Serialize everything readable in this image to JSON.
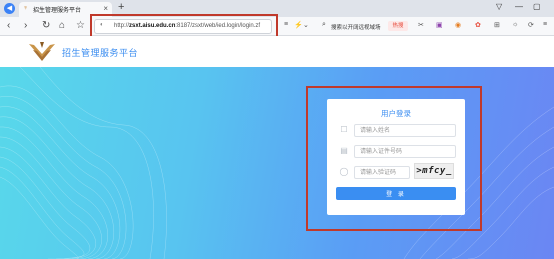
{
  "browser": {
    "tab_title": "招生管理服务平台",
    "new_tab": "+",
    "url_prefix": "http://",
    "url_host": "zsxt.aisu.edu.cn",
    "url_rest": ":8187/zsxt/web/ied.login/login.zf",
    "search_placeholder": "搜索以开阔远视域场",
    "hot_badge": "热搜",
    "icons": [
      "back-icon",
      "forward-icon",
      "reload-icon",
      "home-icon",
      "star-icon",
      "lock-icon",
      "menu-icon",
      "lightning-icon",
      "chevron-down-icon",
      "search-icon",
      "cut-icon",
      "translate-icon",
      "extension-icon",
      "profile-icon",
      "grid-icon",
      "settings-icon",
      "menu-icon"
    ]
  },
  "site": {
    "title": "招生管理服务平台"
  },
  "login": {
    "title": "用户登录",
    "name_placeholder": "请输入姓名",
    "id_placeholder": "请输入证件号码",
    "captcha_placeholder": "请输入验证码",
    "captcha_text": ">mfcy_",
    "submit_label": "登 录"
  },
  "colors": {
    "accent": "#3a8ef2",
    "highlight": "#c0392b",
    "hero_start": "#58d8ea",
    "hero_end": "#6b86f3"
  }
}
